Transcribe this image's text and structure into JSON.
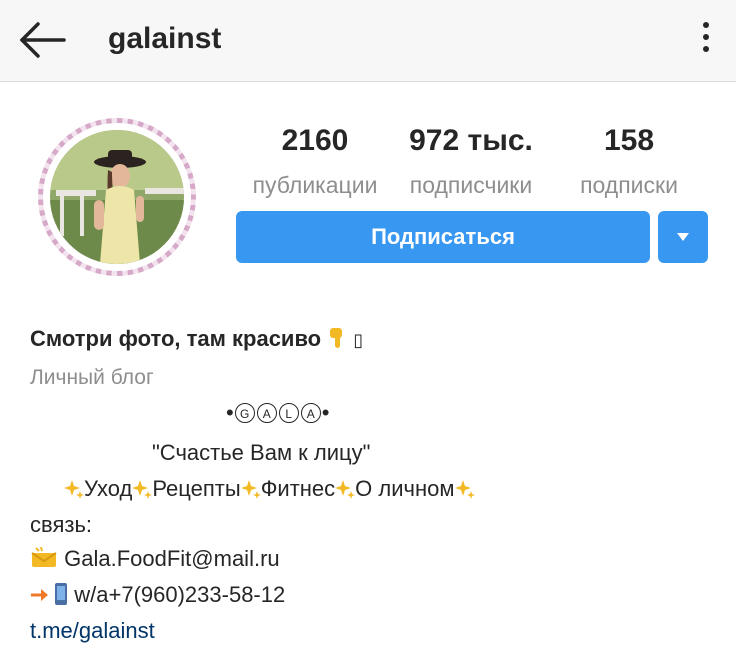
{
  "header": {
    "username": "galainst",
    "back_icon": "arrow-left-icon",
    "more_icon": "more-vertical-icon"
  },
  "stats": [
    {
      "value": "2160",
      "label": "публикации"
    },
    {
      "value": "972 тыс.",
      "label": "подписчики"
    },
    {
      "value": "158",
      "label": "подписки"
    }
  ],
  "actions": {
    "follow_label": "Подписаться"
  },
  "bio": {
    "name": "Смотри фото, там красиво",
    "name_emoji_glyph": "▯",
    "category": "Личный блог",
    "gala_letters": [
      "G",
      "A",
      "L",
      "A"
    ],
    "quote": "\"Счастье Вам к лицу\"",
    "topics": [
      "Уход",
      "Рецепты",
      "Фитнес",
      "О личном"
    ],
    "contact_label": "связь:",
    "email": "Gala.FoodFit@mail.ru",
    "whatsapp": "w/a+7(960)233-58-12",
    "link": "t.me/galainst"
  },
  "colors": {
    "accent": "#3897f0",
    "link": "#003569",
    "muted": "#8e8e8e",
    "text": "#262626",
    "sparkle": "#f2b924"
  }
}
